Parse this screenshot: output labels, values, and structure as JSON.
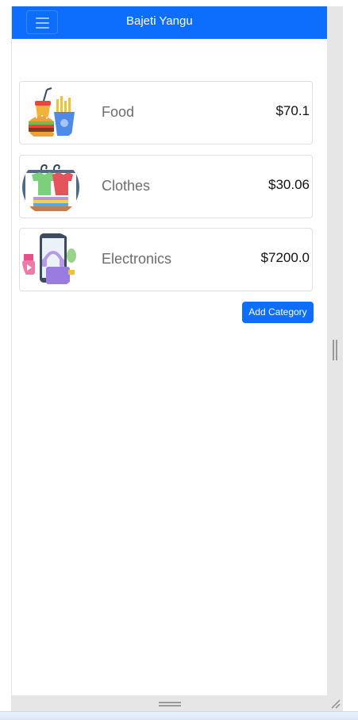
{
  "navbar": {
    "brand": "Bajeti Yangu",
    "toggler_icon": "hamburger-menu-icon",
    "background": "#0d6efd"
  },
  "categories": [
    {
      "name": "Food",
      "amount": "$70.1",
      "icon": "food-burger-fries-icon"
    },
    {
      "name": "Clothes",
      "amount": "$30.06",
      "icon": "clothes-rack-icon"
    },
    {
      "name": "Electronics",
      "amount": "$7200.0",
      "icon": "electronics-devices-icon"
    }
  ],
  "actions": {
    "add_category_label": "Add Category"
  },
  "colors": {
    "primary": "#0d6efd",
    "category_text": "#6c6c6c",
    "amount_text": "#111111"
  }
}
